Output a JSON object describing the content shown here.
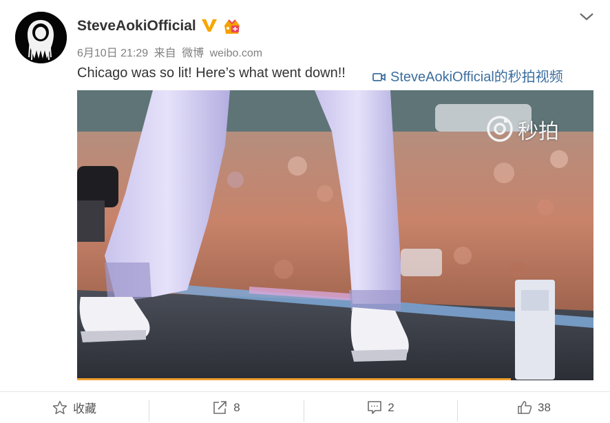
{
  "post": {
    "username": "SteveAokiOfficial",
    "date": "6月10日 21:29",
    "source_prefix": "来自",
    "source_app": "微博",
    "source_domain": "weibo.com",
    "text": "Chicago was so lit! Here’s what went down!!",
    "video_link_label": "SteveAokiOfficial的秒拍视频"
  },
  "video": {
    "watermark": "秒拍",
    "progress": 0.84
  },
  "actions": {
    "favorite_label": "收藏",
    "repost_count": "8",
    "comment_count": "2",
    "like_count": "38"
  },
  "colors": {
    "link": "#3b6e9f",
    "verified_badge": "#f7a600",
    "progress_bar": "#f0a030",
    "text_primary": "#333333",
    "text_meta": "#808080"
  }
}
